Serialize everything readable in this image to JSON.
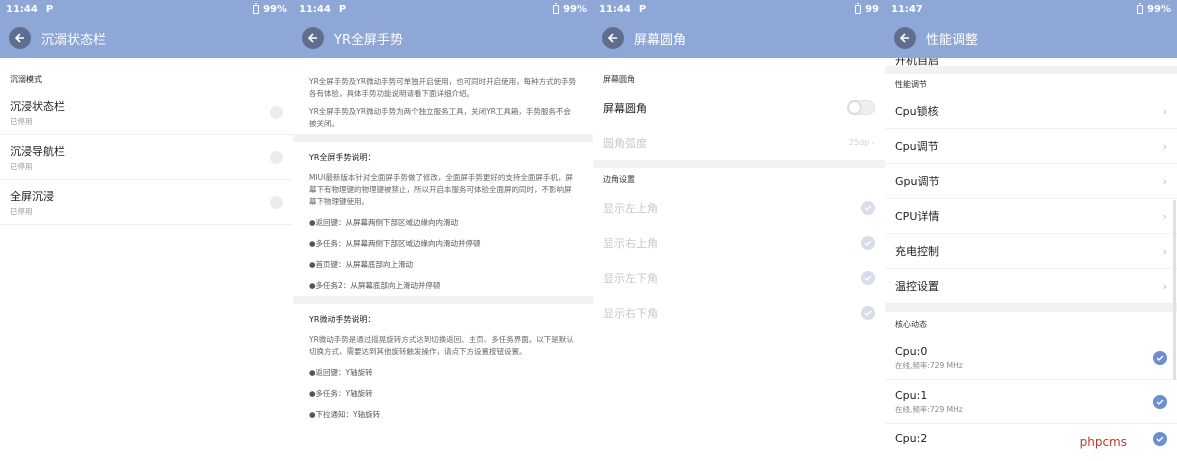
{
  "status": {
    "p1": {
      "time": "11:44",
      "battery": "99%"
    },
    "p2": {
      "time": "11:44",
      "battery": "99%"
    },
    "p3": {
      "time": "11:44",
      "battery": "99"
    },
    "p4": {
      "time": "11:47",
      "battery": "99%"
    }
  },
  "panel1": {
    "title": "沉溺状态栏",
    "section": "沉溺模式",
    "rows": [
      {
        "title": "沉浸状态栏",
        "sub": "已停用"
      },
      {
        "title": "沉浸导航栏",
        "sub": "已停用"
      },
      {
        "title": "全屏沉浸",
        "sub": "已停用"
      }
    ]
  },
  "panel2": {
    "title": "YR全屏手势",
    "intro1": "YR全屏手势及YR微动手势可单独开启使用，也可同时开启使用，每种方式的手势各有体验，具体手势功能说明请看下面详细介绍。",
    "intro2": "YR全屏手势及YR微动手势为两个独立服务工具，关闭YR工具箱，手势服务不会被关闭。",
    "heading1": "YR全屏手势说明：",
    "para1": "MIUI最新版本针对全面屏手势做了修改，全面屏手势更好的支持全面屏手机，屏幕下有物理键的物理键被禁止，所以开启本服务可体验全面屏的同时，不影响屏幕下物理键使用。",
    "bullets1": [
      "●返回键：从屏幕两侧下部区域边缘向内滑动",
      "●多任务：从屏幕两侧下部区域边缘向内滑动并停顿",
      "●首页键：从屏幕底部向上滑动",
      "●多任务2：从屏幕底部向上滑动并停顿"
    ],
    "heading2": "YR微动手势说明：",
    "para2": "YR微动手势是通过摇晃旋转方式达到切换返回、主页、多任务界面。以下是默认切换方式，需要达到其他旋转触发操作，请点下方设置按钮设置。",
    "bullets2": [
      "●返回键：Y轴旋转",
      "●多任务：Y轴旋转",
      "●下拉通知：Y轴旋转"
    ]
  },
  "panel3": {
    "title": "屏幕圆角",
    "section1": "屏幕圆角",
    "toggle_label": "屏幕圆角",
    "radius_label": "圆角弧度",
    "radius_value": "25dp",
    "section2": "边角设置",
    "corners": [
      "显示左上角",
      "显示右上角",
      "显示左下角",
      "显示右下角"
    ]
  },
  "panel4": {
    "title": "性能调整",
    "partial_row": "开机自启",
    "section1": "性能调节",
    "items": [
      "Cpu锁核",
      "Cpu调节",
      "Gpu调节",
      "CPU详情",
      "充电控制",
      "温控设置"
    ],
    "section2": "核心动态",
    "cores": [
      {
        "title": "Cpu:0",
        "sub": "在线,频率:729 MHz"
      },
      {
        "title": "Cpu:1",
        "sub": "在线,频率:729 MHz"
      },
      {
        "title": "Cpu:2",
        "sub": ""
      }
    ]
  },
  "watermark": "phpcms",
  "colors": {
    "header": "#8fa7d6",
    "back_button": "#5f6e8e",
    "check_on": "#6b8fcf"
  }
}
